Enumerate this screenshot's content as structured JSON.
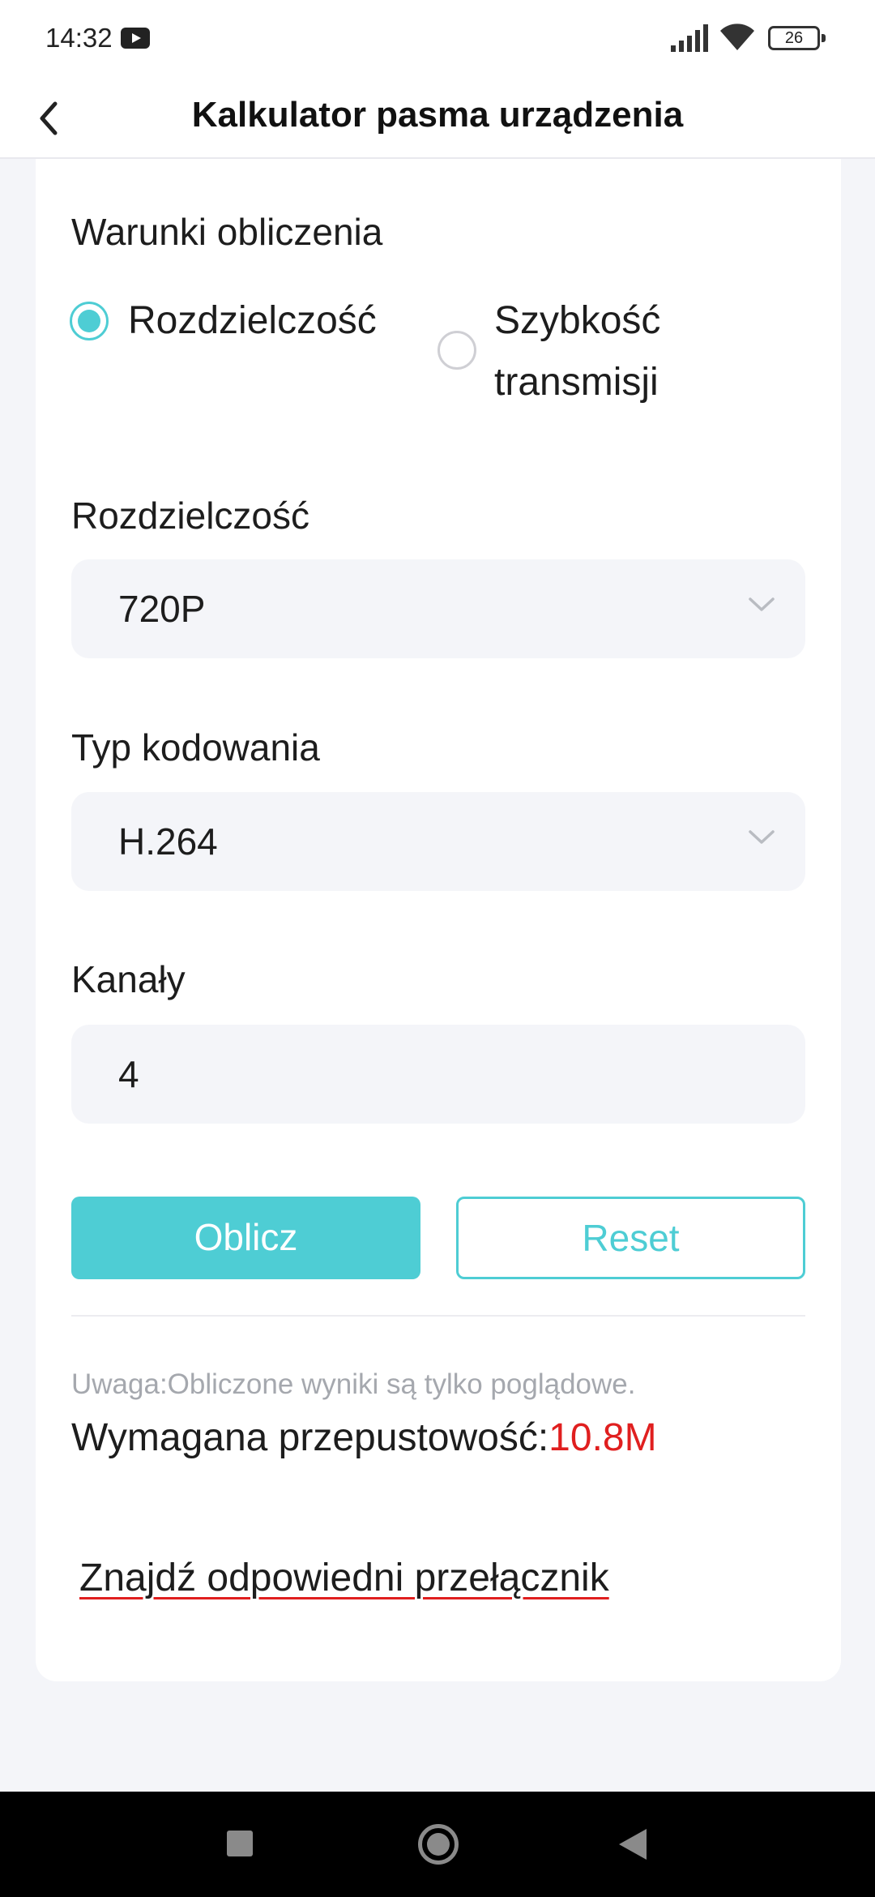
{
  "status_bar": {
    "time": "14:32",
    "battery": "26"
  },
  "header": {
    "title": "Kalkulator pasma urządzenia"
  },
  "form": {
    "conditions_title": "Warunki obliczenia",
    "option_resolution": "Rozdzielczość",
    "option_bitrate_line1": "Szybkość",
    "option_bitrate_line2": "transmisji",
    "selected_option": "Rozdzielczość",
    "resolution_label": "Rozdzielczość",
    "resolution_value": "720P",
    "encoding_label": "Typ kodowania",
    "encoding_value": "H.264",
    "channels_label": "Kanały",
    "channels_value": "4"
  },
  "buttons": {
    "calculate": "Oblicz",
    "reset": "Reset"
  },
  "result": {
    "note": "Uwaga:Obliczone wyniki są tylko poglądowe.",
    "label": "Wymagana przepustowość:",
    "value": "10.8M"
  },
  "link": {
    "find_switch": "Znajdź odpowiedni przełącznik"
  },
  "colors": {
    "accent": "#4ecdd4",
    "result_value": "#e01f1f",
    "background": "#f4f5f9"
  }
}
